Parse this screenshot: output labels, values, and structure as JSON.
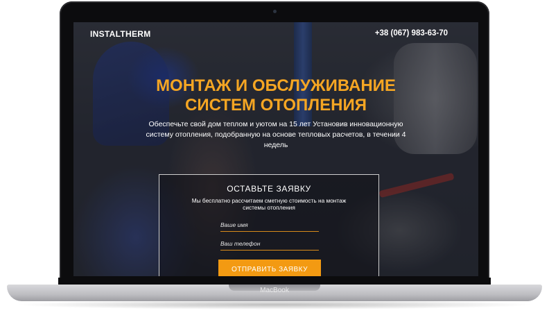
{
  "header": {
    "brand": "INSTALTHERM",
    "phone": "+38 (067) 983-63-70"
  },
  "hero": {
    "title_line1": "МОНТАЖ И ОБСЛУЖИВАНИЕ",
    "title_line2": "СИСТЕМ ОТОПЛЕНИЯ",
    "subtitle": "Обеспечьте свой дом теплом и уютом на 15 лет Установив инновационную систему отопления, подобранную на основе тепловых расчетов, в течении 4 недель"
  },
  "form": {
    "title": "ОСТАВЬТЕ ЗАЯВКУ",
    "description": "Мы бесплатно рассчитаем сметную стоимость на монтаж системы отопления",
    "name_placeholder": "Ваше имя",
    "phone_placeholder": "Ваш телефон",
    "submit_label": "ОТПРАВИТЬ ЗАЯВКУ"
  },
  "device": {
    "label": "MacBook"
  },
  "colors": {
    "accent": "#f39a12",
    "title": "#f5a623"
  }
}
